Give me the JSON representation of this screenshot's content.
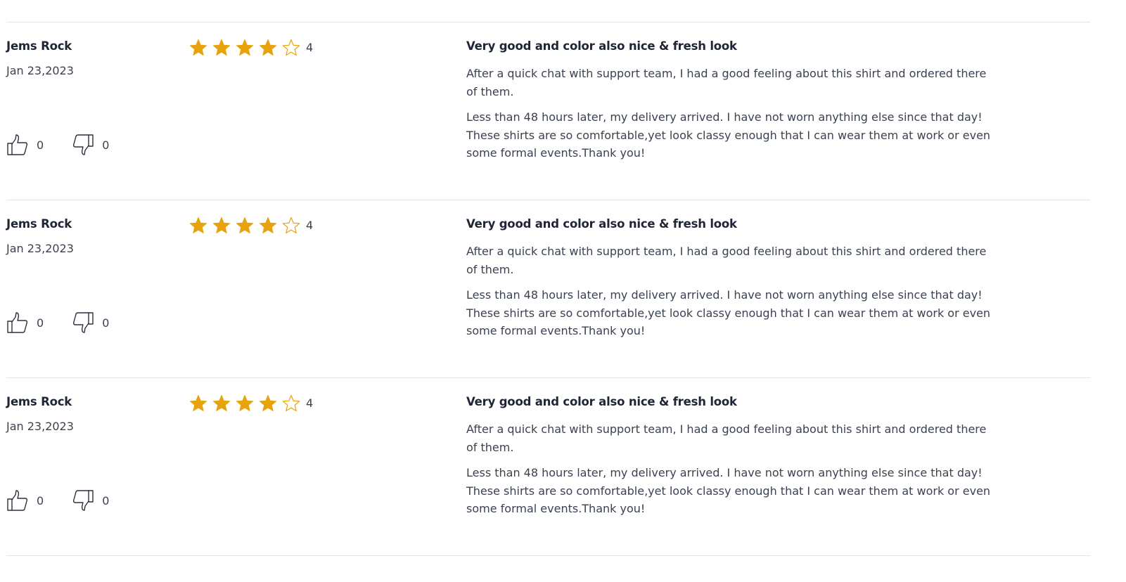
{
  "reviews": [
    {
      "author": "Jems Rock",
      "date": "Jan 23,2023",
      "rating": 4,
      "rating_label": "4",
      "helpful_count": "0",
      "unhelpful_count": "0",
      "title": "Very good and color also nice & fresh look",
      "paragraphs": [
        "After a quick chat with support team, I had a good feeling about this shirt and ordered there of them.",
        "Less than 48 hours later, my delivery arrived. I have not worn anything else since that day! These shirts are so comfortable,yet look classy enough that I can wear them at work or even some formal events.Thank you!"
      ]
    },
    {
      "author": "Jems Rock",
      "date": "Jan 23,2023",
      "rating": 4,
      "rating_label": "4",
      "helpful_count": "0",
      "unhelpful_count": "0",
      "title": "Very good and color also nice & fresh look",
      "paragraphs": [
        "After a quick chat with support team, I had a good feeling about this shirt and ordered there of them.",
        "Less than 48 hours later, my delivery arrived. I have not worn anything else since that day! These shirts are so comfortable,yet look classy enough that I can wear them at work or even some formal events.Thank you!"
      ]
    },
    {
      "author": "Jems Rock",
      "date": "Jan 23,2023",
      "rating": 4,
      "rating_label": "4",
      "helpful_count": "0",
      "unhelpful_count": "0",
      "title": "Very good and color also nice & fresh look",
      "paragraphs": [
        "After a quick chat with support team, I had a good feeling about this shirt and ordered there of them.",
        "Less than 48 hours later, my delivery arrived. I have not worn anything else since that day! These shirts are so comfortable,yet look classy enough that I can wear them at work or even some formal events.Thank you!"
      ]
    }
  ],
  "rating_max": 5,
  "icons": {
    "filled_star": "star-filled-icon",
    "empty_star": "star-outline-icon",
    "helpful": "thumbs-up-icon",
    "unhelpful": "thumbs-down-icon"
  },
  "colors": {
    "star": "#e8a20c",
    "text": "#3a4252",
    "heading": "#1e2535",
    "divider": "#e2e4e8"
  }
}
